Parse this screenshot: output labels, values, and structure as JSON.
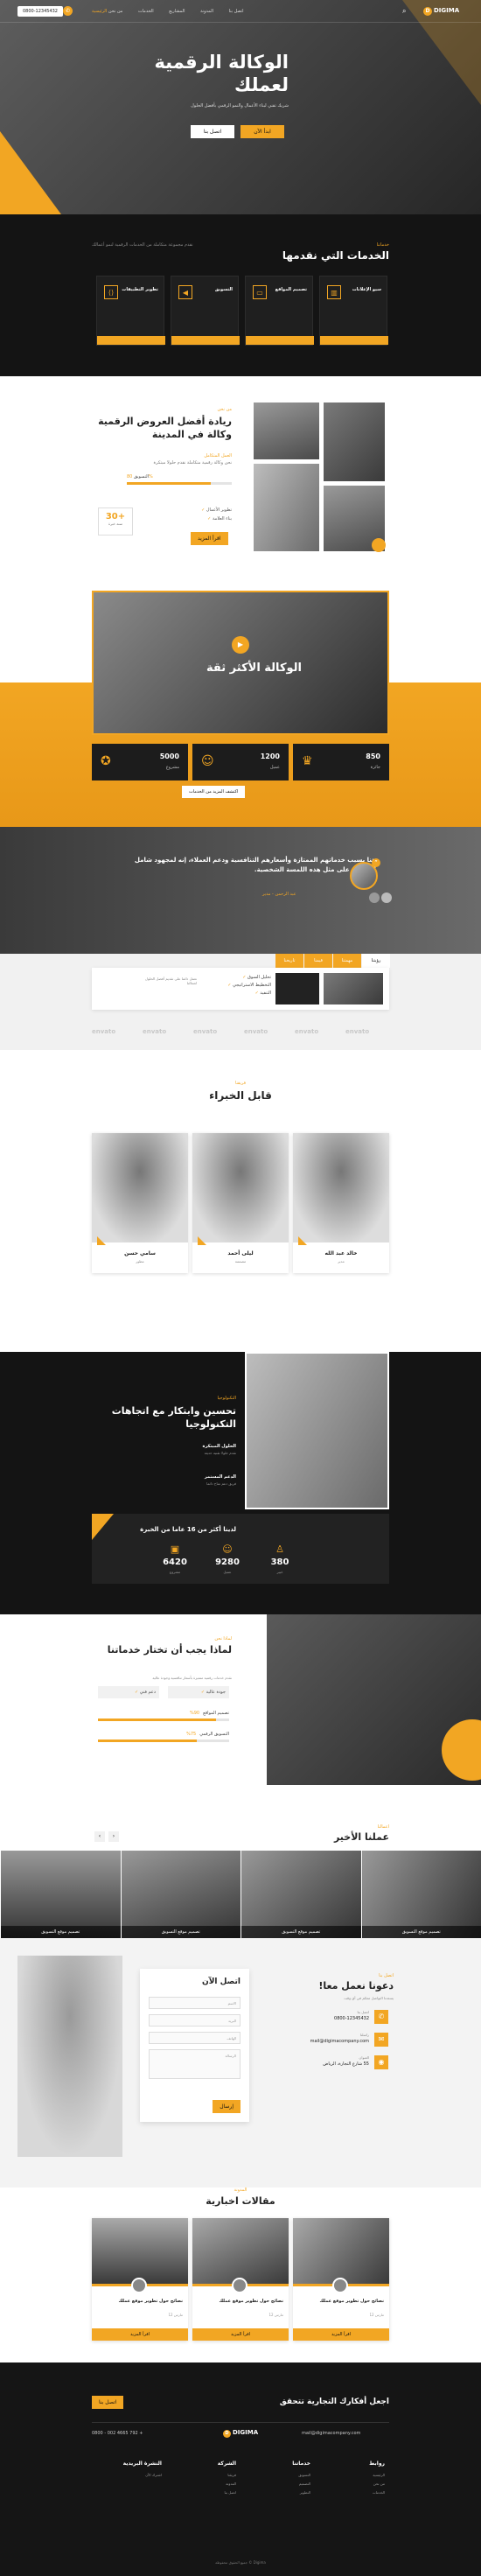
{
  "header": {
    "phone": "0800-12345432",
    "logo": "DIGIMA",
    "logo_glyph": "D",
    "search_icon": "search-icon",
    "nav": [
      "الرئيسية",
      "من نحن",
      "الخدمات",
      "المشاريع",
      "المدونة",
      "اتصل بنا"
    ]
  },
  "hero": {
    "title": "الوكالة الرقمية لعملك",
    "subtitle": "شريك تقني لبناء الأعمال والنمو الرقمي بأفضل الحلول",
    "btn_primary": "ابدأ الآن",
    "btn_secondary": "اتصل بنا"
  },
  "services": {
    "kicker": "خدماتنا",
    "title": "الخدمات التي نقدمها",
    "intro": "نقدم مجموعة متكاملة من الخدمات الرقمية لنمو أعمالك",
    "items": [
      {
        "title": "سيو الإعلانات",
        "icon": "chart-icon"
      },
      {
        "title": "تصميم المواقع",
        "icon": "monitor-icon"
      },
      {
        "title": "التسويق",
        "icon": "megaphone-icon"
      },
      {
        "title": "تطوير التطبيقات",
        "icon": "code-icon"
      }
    ]
  },
  "about": {
    "kicker": "من نحن",
    "title": "ريادة أفضل العروض الرقمية وكالة في المدينة",
    "sub": "العمل المتكامل",
    "text": "نحن وكالة رقمية متكاملة نقدم حلولا مبتكرة",
    "bar_label": "التسويق",
    "bar_value": "80%",
    "bar_fraction": 0.8,
    "checks": [
      "تطوير الأعمال",
      "بناء العلامة"
    ],
    "years": "30+",
    "years_label": "سنة خبرة",
    "button": "اقرأ المزيد"
  },
  "video": {
    "title": "الوكالة الأكثر ثقة",
    "play_icon": "play-icon",
    "stats": [
      {
        "value": "5000",
        "label": "مشروع",
        "icon": "award-icon"
      },
      {
        "value": "1200",
        "label": "عميل",
        "icon": "users-icon"
      },
      {
        "value": "850",
        "label": "جائزة",
        "icon": "trophy-icon"
      }
    ],
    "link": "اكتشف المزيد من الخدمات"
  },
  "testimonial": {
    "quote": "هنا بسبب خدماتهم الممتازة وأسعارهم التنافسية ودعم العملاء، إنه لمجهود شامل للحصول على مثل هذه اللمسة الشخصية.",
    "name": "عبد الرحمن",
    "role": "مدير",
    "quote_icon": "quote-icon"
  },
  "tabs": {
    "items": [
      "رؤيتنا",
      "مهمتنا",
      "قيمنا",
      "تاريخنا"
    ],
    "text": "نعمل دائما على تقديم أفضل الحلول لعملائنا",
    "list": [
      "تحليل السوق",
      "التخطيط الاستراتيجي",
      "التنفيذ"
    ]
  },
  "partners": [
    "envato",
    "envato",
    "envato",
    "envato",
    "envato",
    "envato"
  ],
  "team": {
    "kicker": "فريقنا",
    "title": "قابل الخبراء",
    "members": [
      {
        "name": "خالد عبد الله",
        "role": "مدير"
      },
      {
        "name": "ليلى أحمد",
        "role": "مصممة"
      },
      {
        "name": "سامي حسن",
        "role": "مطور"
      }
    ]
  },
  "tech": {
    "kicker": "التكنولوجيا",
    "title": "تحسين وابتكار مع اتجاهات التكنولوجيا",
    "features": [
      {
        "title": "الحلول المبتكرة",
        "text": "نقدم حلولا تقنية حديثة"
      },
      {
        "title": "الدعم المستمر",
        "text": "فريق دعم متاح دائما"
      }
    ],
    "banner": "لدينا أكثر من 16 عاما من الخبرة",
    "counters": [
      {
        "value": "6420",
        "label": "مشروع",
        "icon": "briefcase-icon"
      },
      {
        "value": "9280",
        "label": "عميل",
        "icon": "smile-icon"
      },
      {
        "value": "380",
        "label": "خبير",
        "icon": "user-icon"
      }
    ]
  },
  "why": {
    "kicker": "لماذا نحن",
    "title": "لماذا يجب أن تختار خدماتنا",
    "text": "نقدم خدمات رقمية متميزة بأسعار تنافسية وجودة عالية",
    "boxes": [
      "جودة عالية",
      "دعم فني"
    ],
    "bars": [
      {
        "label": "تصميم المواقع",
        "value": "90%",
        "fraction": 0.9
      },
      {
        "label": "التسويق الرقمي",
        "value": "75%",
        "fraction": 0.75
      }
    ]
  },
  "work": {
    "kicker": "أعمالنا",
    "title": "عملنا الأخير",
    "prev_icon": "chevron-left-icon",
    "next_icon": "chevron-right-icon",
    "items": [
      {
        "title": "تصميم موقع التسويق"
      },
      {
        "title": "تصميم موقع التسويق"
      },
      {
        "title": "تصميم موقع التسويق"
      },
      {
        "title": "تصميم موقع التسويق"
      }
    ]
  },
  "contact": {
    "kicker": "اتصل بنا",
    "title": "دعونا نعمل معا!",
    "text": "يسعدنا التواصل معكم في أي وقت",
    "info": [
      {
        "label": "اتصل بنا",
        "value": "0800-12345432",
        "icon": "phone-icon"
      },
      {
        "label": "راسلنا",
        "value": "mail@digimacompany.com",
        "icon": "mail-icon"
      },
      {
        "label": "العنوان",
        "value": "55 شارع التجارة، الرياض",
        "icon": "map-pin-icon"
      }
    ],
    "form_title": "اتصل الآن",
    "fields": [
      "الاسم",
      "البريد",
      "الهاتف",
      "الرسالة"
    ],
    "submit": "إرسال"
  },
  "blog": {
    "kicker": "المدونة",
    "title": "مقالات اخبارية",
    "posts": [
      {
        "title": "نصائح حول تطوير موقع عملك",
        "date": "12 مارس"
      },
      {
        "title": "نصائح حول تطوير موقع عملك",
        "date": "12 مارس"
      },
      {
        "title": "نصائح حول تطوير موقع عملك",
        "date": "12 مارس"
      }
    ],
    "more": "اقرأ المزيد"
  },
  "cta": {
    "title": "اجعل أفكارك التجارية تتحقق",
    "button": "اتصل بنا"
  },
  "footer": {
    "email": "mail@digimacompany.com",
    "logo": "DIGIMA",
    "phone": "0800 - 002 4665 792 +",
    "cols": [
      {
        "title": "روابط",
        "items": [
          "الرئيسية",
          "من نحن",
          "الخدمات"
        ]
      },
      {
        "title": "خدماتنا",
        "items": [
          "التسويق",
          "التصميم",
          "التطوير"
        ]
      },
      {
        "title": "الشركة",
        "items": [
          "فريقنا",
          "المدونة",
          "اتصل بنا"
        ]
      },
      {
        "title": "النشرة البريدية",
        "items": [
          "اشترك الآن"
        ]
      }
    ],
    "copyright": "جميع الحقوق محفوظة © Digima"
  },
  "colors": {
    "accent": "#f2a623",
    "dark": "#1a1a1a"
  }
}
